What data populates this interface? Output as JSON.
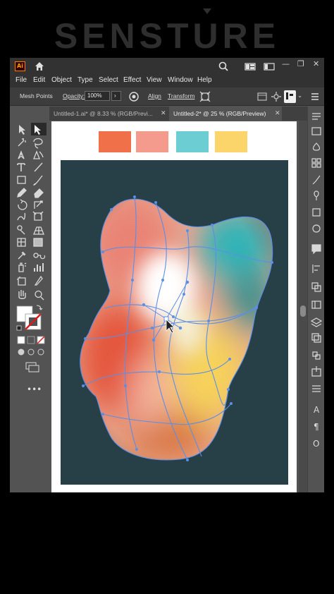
{
  "brand": {
    "name": "SENSTURE"
  },
  "window": {
    "app_logo": "Ai",
    "controls": [
      "—",
      "❐",
      "✕"
    ],
    "icons": [
      "home-icon",
      "search-icon",
      "arrange-docs-icon",
      "workspace-icon"
    ]
  },
  "menu": [
    "File",
    "Edit",
    "Object",
    "Type",
    "Select",
    "Effect",
    "View",
    "Window",
    "Help"
  ],
  "control_bar": {
    "selection_label": "Mesh Points",
    "opacity_label": "Opacity:",
    "opacity_value": "100%",
    "align_label": "Align",
    "transform_label": "Transform"
  },
  "tabs": [
    {
      "label": "Untitled-1.ai* @ 8.33 % (RGB/Previ...",
      "active": false
    },
    {
      "label": "Untitled-2* @ 25 % (RGB/Preview)",
      "active": true
    }
  ],
  "swatches": [
    {
      "name": "orange",
      "color": "#f0704a"
    },
    {
      "name": "salmon",
      "color": "#f59b8e"
    },
    {
      "name": "teal",
      "color": "#6ccdd2"
    },
    {
      "name": "yellow",
      "color": "#fbd46a"
    }
  ],
  "colors": {
    "background": "#273f47",
    "fill": "#ffffff",
    "stroke": "#d91c1c",
    "mesh_line": "#5a8fe8"
  },
  "tools": [
    "selection-tool",
    "direct-selection-tool",
    "magic-wand-tool",
    "lasso-tool",
    "pen-tool",
    "curvature-tool",
    "type-tool",
    "line-tool",
    "rectangle-tool",
    "paintbrush-tool",
    "pencil-tool",
    "eraser-tool",
    "rotate-tool",
    "scale-tool",
    "warp-tool",
    "free-transform-tool",
    "shape-builder-tool",
    "perspective-grid-tool",
    "mesh-tool",
    "gradient-tool",
    "eyedropper-tool",
    "blend-tool",
    "symbol-sprayer-tool",
    "column-graph-tool",
    "artboard-tool",
    "slice-tool",
    "hand-tool",
    "zoom-tool"
  ],
  "right_panel_icons": [
    "properties-icon",
    "libraries-icon",
    "color-icon",
    "swatches-icon",
    "brushes-icon",
    "symbols-icon",
    "graphic-styles-icon",
    "appearance-icon",
    "comment-icon",
    "align-panel-icon",
    "pathfinder-icon",
    "transform-panel-icon",
    "layers-icon",
    "artboards-icon",
    "links-icon",
    "asset-export-icon",
    "stroke-panel-icon",
    "character-icon",
    "paragraph-icon",
    "opentype-icon"
  ]
}
